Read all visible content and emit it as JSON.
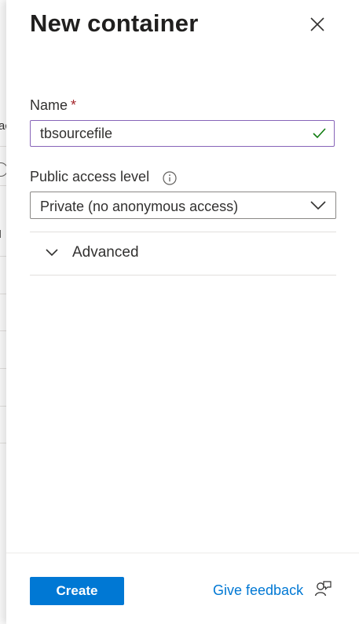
{
  "background": {
    "fragments": [
      "ac",
      "I"
    ]
  },
  "panel": {
    "title": "New container"
  },
  "form": {
    "name_label": "Name",
    "required_marker": "*",
    "name_value": "tbsourcefile",
    "access_label": "Public access level",
    "access_value": "Private (no anonymous access)",
    "advanced_label": "Advanced"
  },
  "footer": {
    "create_label": "Create",
    "feedback_label": "Give feedback"
  },
  "colors": {
    "accent": "#0078d4",
    "input_focus_border": "#8764b8",
    "valid_check": "#107c10",
    "required": "#a4262c"
  },
  "icons": [
    "close-icon",
    "checkmark-icon",
    "info-icon",
    "chevron-down-icon",
    "feedback-icon"
  ]
}
